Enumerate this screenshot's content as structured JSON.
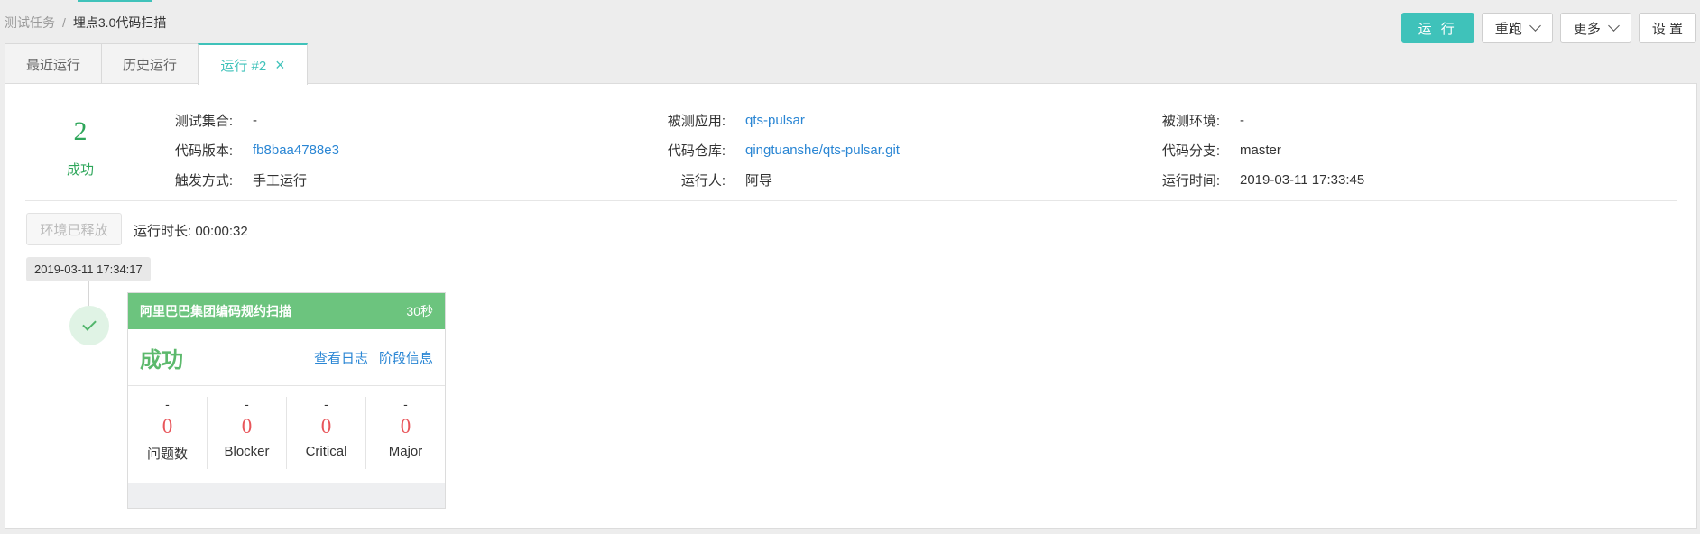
{
  "breadcrumb": {
    "parent": "测试任务",
    "separator": "/",
    "current": "埋点3.0代码扫描"
  },
  "actions": {
    "run": "运 行",
    "rerun": "重跑",
    "more": "更多",
    "settings": "设 置"
  },
  "tabs": [
    {
      "label": "最近运行"
    },
    {
      "label": "历史运行"
    },
    {
      "label": "运行 #2",
      "close": "×"
    }
  ],
  "summary": {
    "count": "2",
    "status": "成功"
  },
  "info": {
    "test_set_label": "测试集合:",
    "test_set": "-",
    "app_label": "被测应用:",
    "app": "qts-pulsar",
    "env_label": "被测环境:",
    "env": "-",
    "version_label": "代码版本:",
    "version": "fb8baa4788e3",
    "repo_label": "代码仓库:",
    "repo": "qingtuanshe/qts-pulsar.git",
    "branch_label": "代码分支:",
    "branch": "master",
    "trigger_label": "触发方式:",
    "trigger": "手工运行",
    "runner_label": "运行人:",
    "runner": "阿导",
    "time_label": "运行时间:",
    "time": "2019-03-11 17:33:45"
  },
  "env_released": "环境已释放",
  "duration": "运行时长: 00:00:32",
  "stage": {
    "timestamp": "2019-03-11 17:34:17",
    "name": "阿里巴巴集团编码规约扫描",
    "duration": "30秒",
    "status": "成功",
    "view_log": "查看日志",
    "stage_info": "阶段信息",
    "metrics": [
      {
        "dash": "-",
        "value": "0",
        "label": "问题数"
      },
      {
        "dash": "-",
        "value": "0",
        "label": "Blocker"
      },
      {
        "dash": "-",
        "value": "0",
        "label": "Critical"
      },
      {
        "dash": "-",
        "value": "0",
        "label": "Major"
      }
    ]
  },
  "colors": {
    "accent": "#3fc2ba",
    "success": "#2ea65a",
    "card_header": "#6cc47e",
    "link": "#2a86d4",
    "metric": "#e8555a"
  }
}
